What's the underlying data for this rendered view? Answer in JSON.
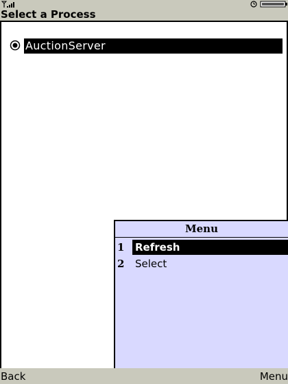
{
  "status_bar": {
    "signal_icon": "signal-strength-icon",
    "battery_icon": "battery-icon",
    "alarm_icon": "alarm-clock-icon"
  },
  "title": "Select a Process",
  "process_list": {
    "items": [
      {
        "label": "AuctionServer",
        "selected": true
      }
    ]
  },
  "menu": {
    "title": "Menu",
    "items": [
      {
        "number": "1",
        "label": "Refresh",
        "selected": true
      },
      {
        "number": "2",
        "label": "Select",
        "selected": false
      }
    ]
  },
  "softkeys": {
    "left": "Back",
    "right": "Menu"
  },
  "colors": {
    "chrome": "#c9c9bc",
    "menu_bg": "#d9d9ff",
    "highlight": "#000000"
  }
}
